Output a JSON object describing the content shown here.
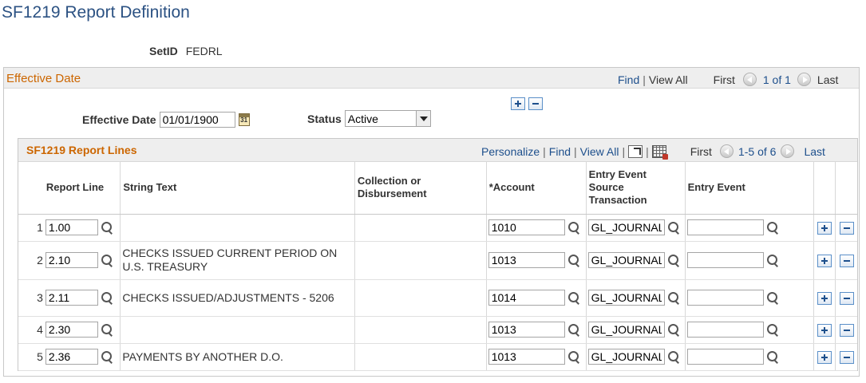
{
  "page": {
    "title": "SF1219 Report Definition"
  },
  "setid": {
    "label": "SetID",
    "value": "FEDRL"
  },
  "effective": {
    "section_title": "Effective Date",
    "find": "Find",
    "view_all": "View All",
    "first": "First",
    "count": "1 of 1",
    "last": "Last",
    "date_label": "Effective Date",
    "date_value": "01/01/1900",
    "status_label": "Status",
    "status_value": "Active"
  },
  "report_lines": {
    "section_title": "SF1219 Report Lines",
    "personalize": "Personalize",
    "find": "Find",
    "view_all": "View All",
    "first": "First",
    "count": "1-5 of 6",
    "last": "Last",
    "columns": {
      "report_line": "Report Line",
      "string_text": "String Text",
      "collection": "Collection or Disbursement",
      "account": "*Account",
      "entry_event_src": "Entry Event Source Transaction",
      "entry_event": "Entry Event"
    },
    "rows": [
      {
        "num": "1",
        "line": "1.00",
        "text": "",
        "account": "1010",
        "source": "GL_JOURNAL",
        "event": ""
      },
      {
        "num": "2",
        "line": "2.10",
        "text": "CHECKS ISSUED CURRENT PERIOD ON U.S. TREASURY",
        "account": "1013",
        "source": "GL_JOURNAL",
        "event": ""
      },
      {
        "num": "3",
        "line": "2.11",
        "text": "CHECKS ISSUED/ADJUSTMENTS - 5206",
        "account": "1014",
        "source": "GL_JOURNAL",
        "event": ""
      },
      {
        "num": "4",
        "line": "2.30",
        "text": "",
        "account": "1013",
        "source": "GL_JOURNAL",
        "event": ""
      },
      {
        "num": "5",
        "line": "2.36",
        "text": "PAYMENTS BY ANOTHER D.O.",
        "account": "1013",
        "source": "GL_JOURNAL",
        "event": ""
      }
    ]
  },
  "icons": {
    "calendar": "calendar-icon",
    "lookup": "magnifier-icon",
    "add": "plus-icon",
    "remove": "minus-icon",
    "zoom": "new-window-icon",
    "download": "spreadsheet-icon",
    "prev": "prev-arrow-icon",
    "next": "next-arrow-icon"
  },
  "colors": {
    "title": "#2c5283",
    "section": "#cc6600",
    "link": "#1d4f8c"
  }
}
